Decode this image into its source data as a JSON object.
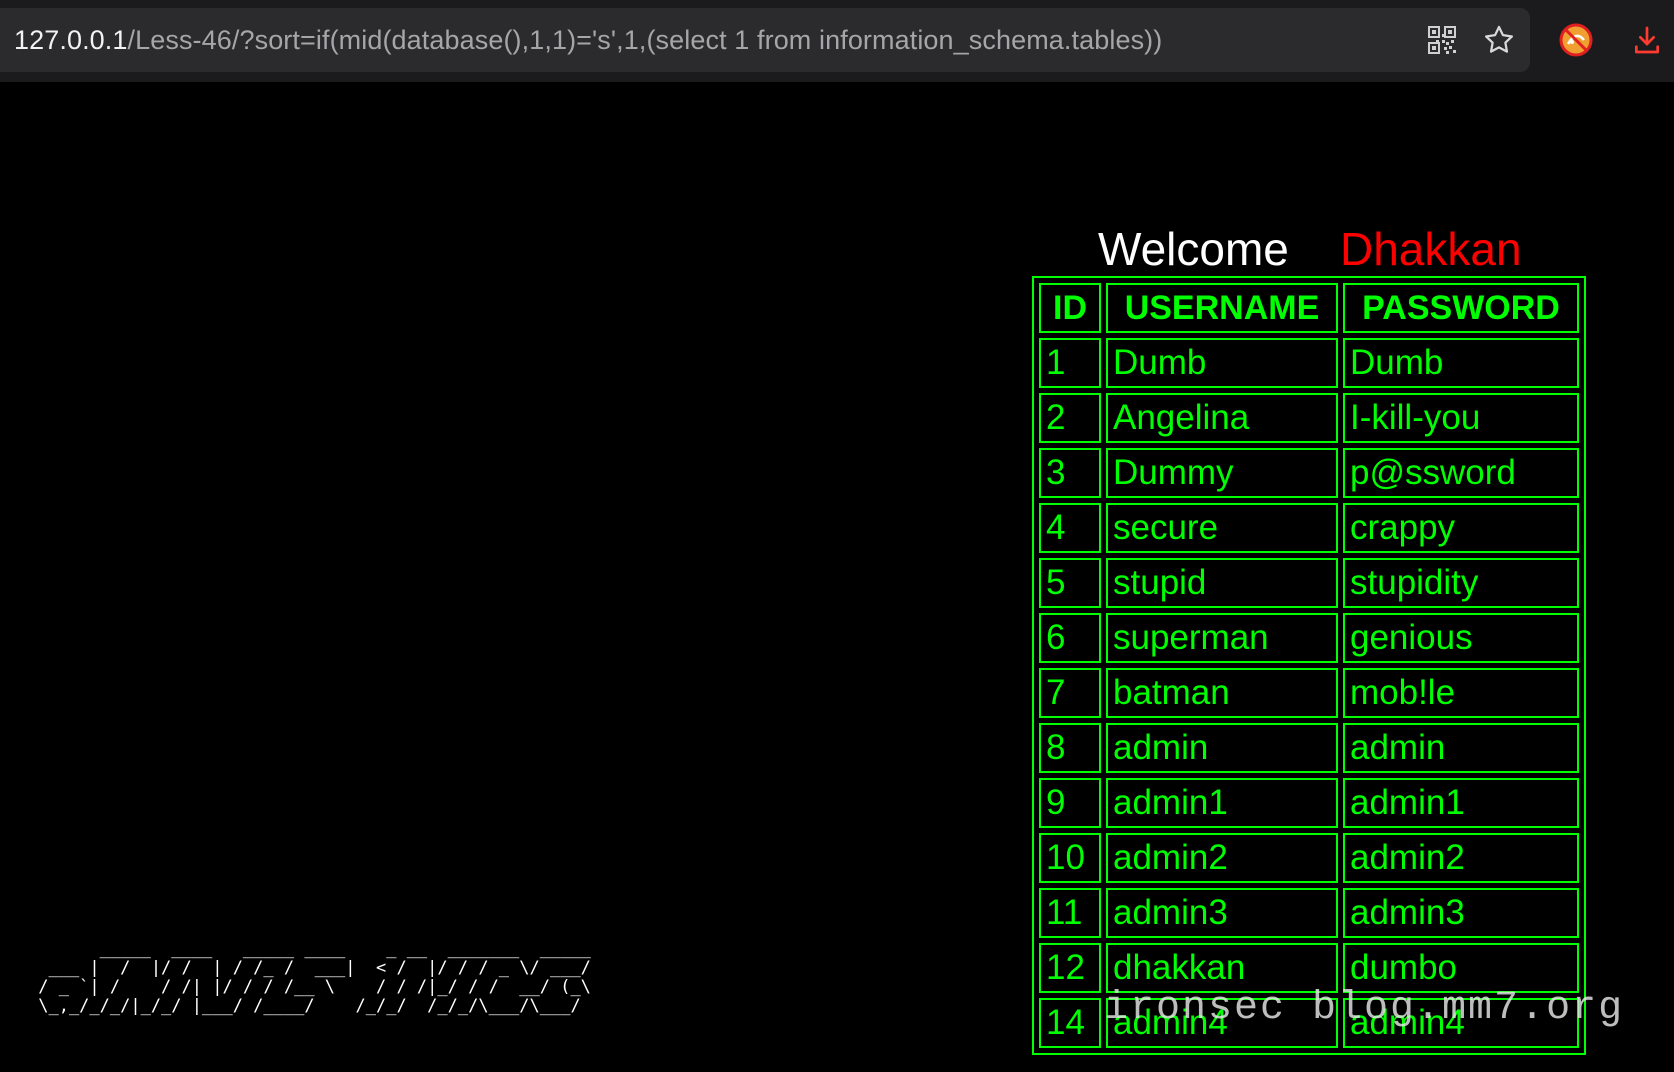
{
  "browser": {
    "url_host": "127.0.0.1",
    "url_path": "/Less-46/?sort=if(mid(database(),1,1)='s',1,(select 1 from information_schema.tables))",
    "icons": [
      "qr-code-icon",
      "bookmark-star-icon",
      "extension-icon",
      "download-icon"
    ],
    "colors": {
      "chrome_bg": "#1b1b1d",
      "urlbar_bg": "#2b2b2e",
      "download_accent": "#ff3b30"
    }
  },
  "page": {
    "welcome": "Welcome",
    "user_name": "Dhakkan",
    "colors": {
      "background": "#000000",
      "welcome": "#ffffff",
      "user_name": "#ff0000",
      "table": "#00ff00"
    },
    "table": {
      "headers": [
        "ID",
        "USERNAME",
        "PASSWORD"
      ],
      "rows": [
        [
          "1",
          "Dumb",
          "Dumb"
        ],
        [
          "2",
          "Angelina",
          "I-kill-you"
        ],
        [
          "3",
          "Dummy",
          "p@ssword"
        ],
        [
          "4",
          "secure",
          "crappy"
        ],
        [
          "5",
          "stupid",
          "stupidity"
        ],
        [
          "6",
          "superman",
          "genious"
        ],
        [
          "7",
          "batman",
          "mob!le"
        ],
        [
          "8",
          "admin",
          "admin"
        ],
        [
          "9",
          "admin1",
          "admin1"
        ],
        [
          "10",
          "admin2",
          "admin2"
        ],
        [
          "11",
          "admin3",
          "admin3"
        ],
        [
          "12",
          "dhakkan",
          "dumbo"
        ],
        [
          "14",
          "admin4",
          "admin4"
        ]
      ]
    },
    "ascii_logo": "       _____  ____   _____ ____    _ __  _______  _____ \n  ___ |  /  |/ /  | / /_ /  ___|  < /  |/ / / _ \\/ ___/ \n / _ `| /    / /| |/ / / /__ \\    / / /|_/ / /  __/ (_\\ \n \\_,_/_/_/|_/_/ |___/ /____/    /_/_/  /_/_/\\___/\\___/ ",
    "watermark": "ironsec blog.mm7.org"
  }
}
